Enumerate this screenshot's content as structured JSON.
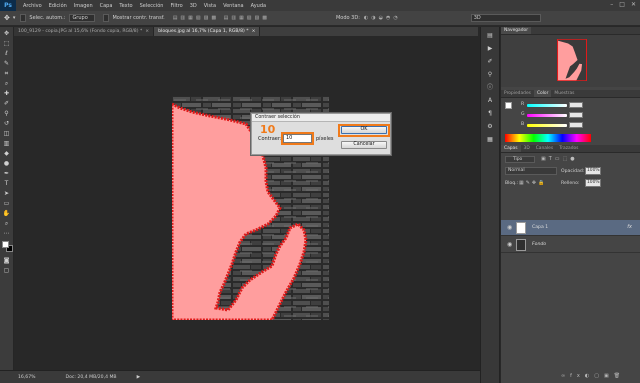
{
  "app": {
    "logo": "Ps"
  },
  "menu": [
    "Archivo",
    "Edición",
    "Imagen",
    "Capa",
    "Texto",
    "Selección",
    "Filtro",
    "3D",
    "Vista",
    "Ventana",
    "Ayuda"
  ],
  "window_controls": {
    "minimize": "–",
    "maximize": "□",
    "close": "✕"
  },
  "options_bar": {
    "sample_label": "Selec. autom.:",
    "sample_value": "Grupo",
    "transform_label": "Mostrar contr. transf.",
    "mode_3d": "Modo 3D:",
    "workspace_value": "3D"
  },
  "tabs": [
    {
      "label": "100_9129 - copia.JPG al 15,6% (Fondo copia, RGB/8) *",
      "close": "×"
    },
    {
      "label": "bloques.jpg al 16,7% (Capa 1, RGB/8) *",
      "close": "×"
    }
  ],
  "status": {
    "zoom": "16,67%",
    "doc": "Doc: 20,4 MB/20,4 MB",
    "arrow": "▶"
  },
  "dialog": {
    "title": "Contraer selección",
    "annotation": "10",
    "field_label": "Contraer:",
    "field_value": "10",
    "unit": "píxeles",
    "ok": "OK",
    "cancel": "Cancelar",
    "highlight_color": "#f07a1a"
  },
  "navigator": {
    "tab": "Navegador"
  },
  "color_panel": {
    "tabs": [
      "Propiedades",
      "Color",
      "Muestras"
    ],
    "channels": [
      {
        "letter": "R",
        "value": ""
      },
      {
        "letter": "G",
        "value": ""
      },
      {
        "letter": "B",
        "value": ""
      }
    ]
  },
  "layers_panel": {
    "tabs": [
      "Capas",
      "3D",
      "Canales",
      "Trazados"
    ],
    "filter": "Tipo",
    "blend_mode": "Normal",
    "opacity_label": "Opacidad:",
    "opacity_value": "100%",
    "lock_label": "Bloq.:",
    "fill_label": "Relleno:",
    "fill_value": "100%",
    "layers": [
      {
        "name": "Capa 1",
        "selected": true,
        "fx": "fx"
      },
      {
        "name": "Fondo",
        "selected": false,
        "fx": ""
      }
    ]
  },
  "colors": {
    "selection_pink": "#ff9e9e",
    "selection_edge": "#e01a1a",
    "accent_orange": "#f07a1a"
  }
}
